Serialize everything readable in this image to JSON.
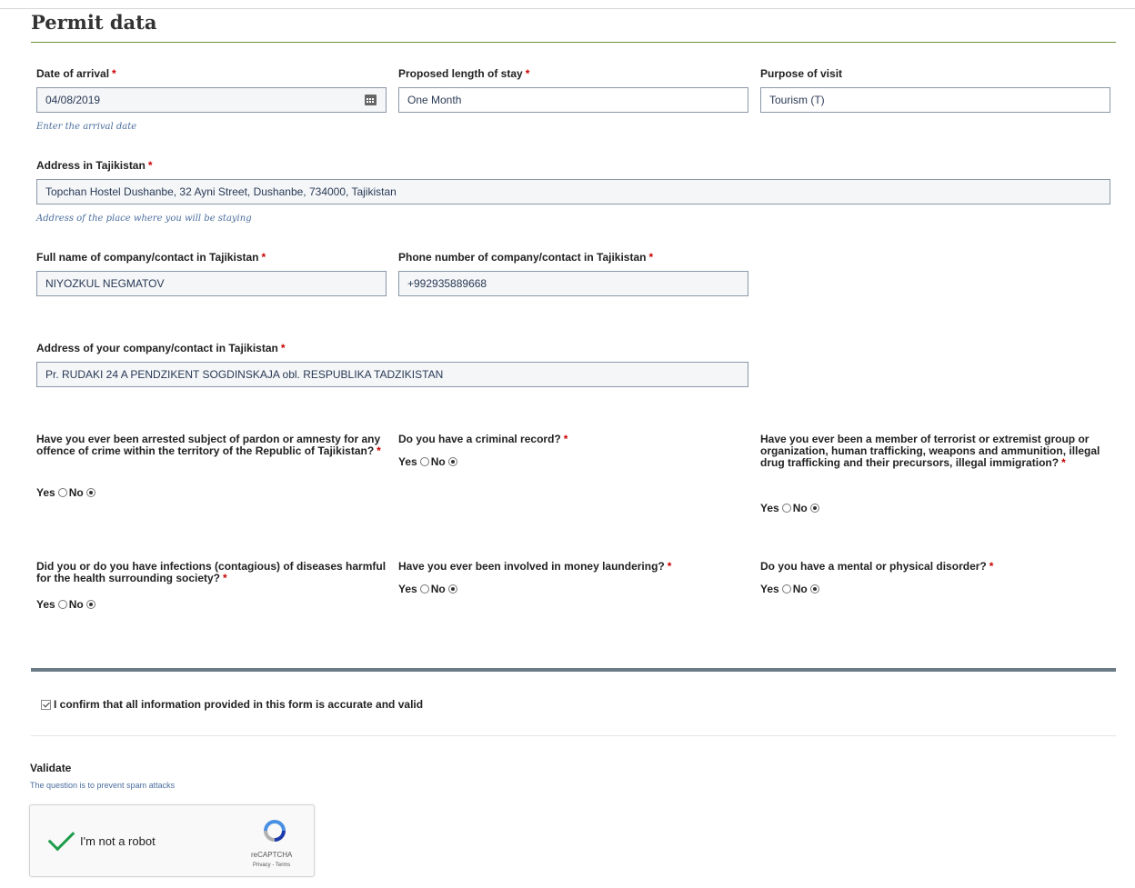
{
  "section": {
    "title": "Permit data"
  },
  "arrival": {
    "label": "Date of arrival",
    "value": "04/08/2019",
    "hint": "Enter the arrival date"
  },
  "stay": {
    "label": "Proposed length of stay",
    "value": "One Month"
  },
  "purpose": {
    "label": "Purpose of visit",
    "value": "Tourism (T)"
  },
  "address": {
    "label": "Address in Tajikistan",
    "value": "Topchan Hostel Dushanbe, 32 Ayni Street, Dushanbe, 734000, Tajikistan",
    "hint": "Address of the place where you will be staying"
  },
  "contact_name": {
    "label": "Full name of company/contact in Tajikistan",
    "value": "NIYOZKUL NEGMATOV"
  },
  "contact_phone": {
    "label": "Phone number of company/contact in Tajikistan",
    "value": "+992935889668"
  },
  "contact_address": {
    "label": "Address of your company/contact in Tajikistan",
    "value": "Pr. RUDAKI 24 A PENDZIKENT SOGDINSKAJA obl. RESPUBLIKA TADZIKISTAN"
  },
  "required_mark": "*",
  "yes_label": "Yes",
  "no_label": "No",
  "questions": [
    {
      "text": "Have you ever been arrested subject of pardon or amnesty for any offence of crime within the territory of the Republic of Tajikistan?",
      "selected": "No"
    },
    {
      "text": "Do you have a criminal record?",
      "selected": "No"
    },
    {
      "text": "Have you ever been a member of terrorist or extremist group or organization, human trafficking, weapons and ammunition, illegal drug trafficking and their precursors, illegal immigration?",
      "selected": "No"
    },
    {
      "text": "Did you or do you have infections (contagious) of diseases harmful for the health surrounding society?",
      "selected": "No"
    },
    {
      "text": "Have you ever been involved in money laundering?",
      "selected": "No"
    },
    {
      "text": "Do you have a mental or physical disorder?",
      "selected": "No"
    }
  ],
  "confirm": {
    "label": "I confirm that all information provided in this form is accurate and valid",
    "checked": true
  },
  "validate": {
    "title": "Validate",
    "subtitle": "The question is to prevent spam attacks"
  },
  "captcha": {
    "label": "I'm not a robot",
    "brand": "reCAPTCHA",
    "links": "Privacy - Terms"
  },
  "colors": {
    "required": "#cc0000",
    "hint": "#4a6e9e",
    "title_rule": "#6d8e3c",
    "check_green": "#1e9d4b"
  }
}
